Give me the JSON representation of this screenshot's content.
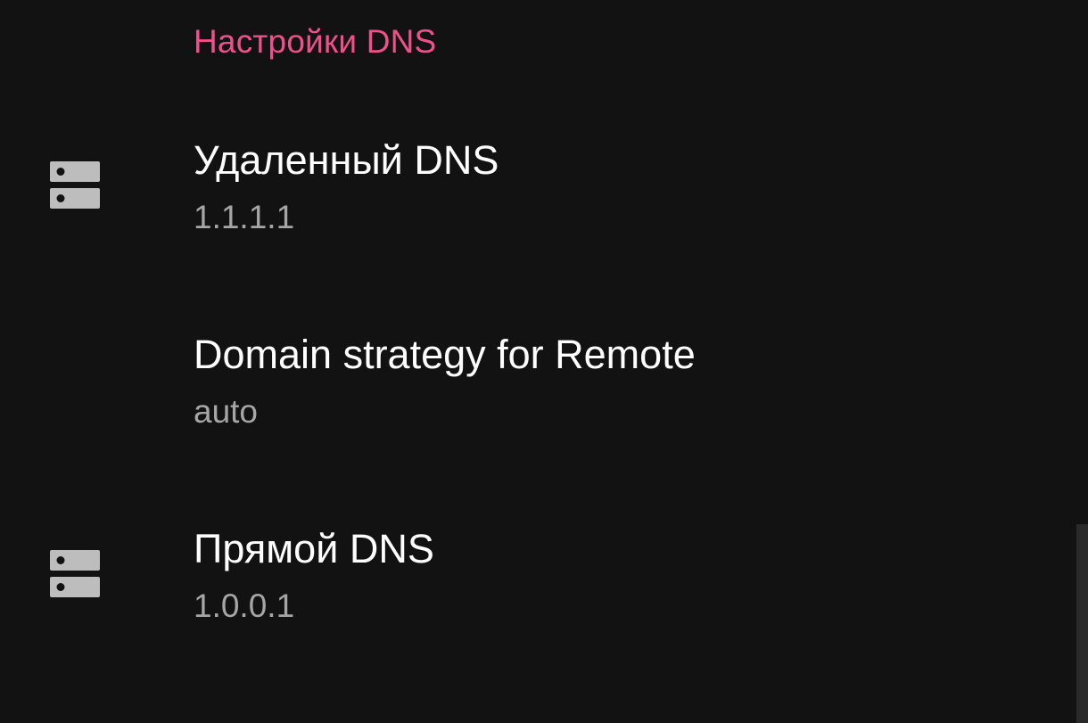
{
  "section": {
    "title": "Настройки DNS",
    "accent_color": "#f0508a"
  },
  "items": [
    {
      "title": "Удаленный DNS",
      "summary": "1.1.1.1",
      "icon": "dns-server-icon"
    },
    {
      "title": "Domain strategy for Remote",
      "summary": "auto",
      "icon": ""
    },
    {
      "title": "Прямой DNS",
      "summary": "1.0.0.1",
      "icon": "dns-server-icon"
    }
  ]
}
